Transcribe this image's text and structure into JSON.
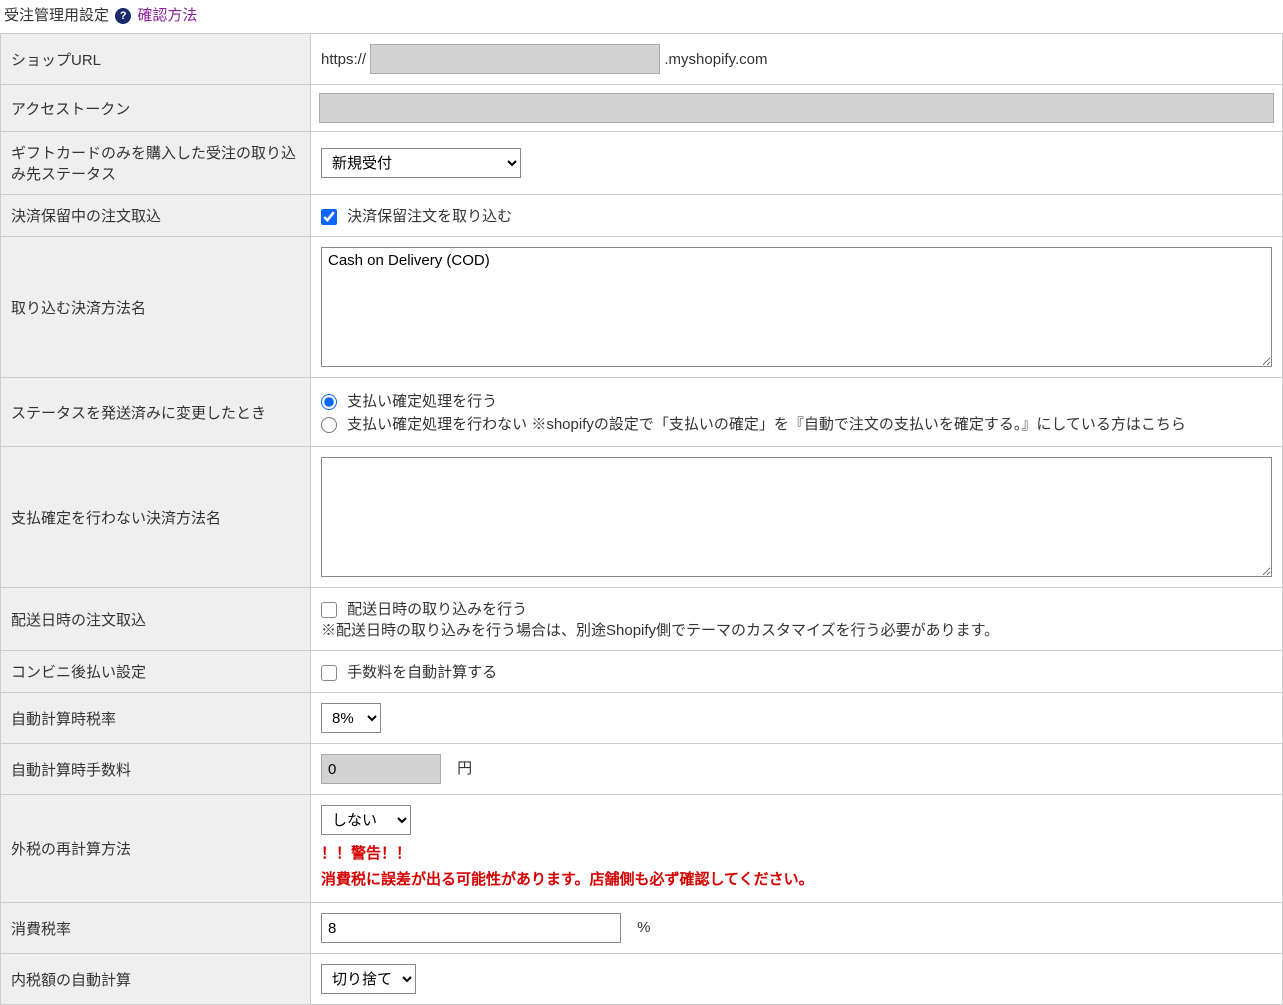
{
  "header": {
    "title": "受注管理用設定",
    "help_glyph": "?",
    "help_link": "確認方法"
  },
  "rows": {
    "shop_url": {
      "label": "ショップURL",
      "prefix": "https://",
      "value": "",
      "suffix": ".myshopify.com"
    },
    "access_token": {
      "label": "アクセストークン",
      "value": ""
    },
    "giftcard_status": {
      "label": "ギフトカードのみを購入した受注の取り込み先ステータス",
      "selected": "新規受付",
      "options": [
        "新規受付"
      ]
    },
    "pending_import": {
      "label": "決済保留中の注文取込",
      "checkbox_label": "決済保留注文を取り込む",
      "checked": true
    },
    "payment_methods_import": {
      "label": "取り込む決済方法名",
      "value": "Cash on Delivery (COD)"
    },
    "on_shipped": {
      "label": "ステータスを発送済みに変更したとき",
      "option1": "支払い確定処理を行う",
      "option2": "支払い確定処理を行わない ※shopifyの設定で「支払いの確定」を『自動で注文の支払いを確定する。』にしている方はこちら",
      "selected": 1
    },
    "exclude_capture_methods": {
      "label": "支払確定を行わない決済方法名",
      "value": ""
    },
    "delivery_datetime": {
      "label": "配送日時の注文取込",
      "checkbox_label": "配送日時の取り込みを行う",
      "checked": false,
      "note": "※配送日時の取り込みを行う場合は、別途Shopify側でテーマのカスタマイズを行う必要があります。"
    },
    "convenience_postpay": {
      "label": "コンビニ後払い設定",
      "checkbox_label": "手数料を自動計算する",
      "checked": false
    },
    "auto_tax_rate": {
      "label": "自動計算時税率",
      "selected": "8%",
      "options": [
        "8%"
      ]
    },
    "auto_fee": {
      "label": "自動計算時手数料",
      "value": "0",
      "unit": "円"
    },
    "ext_tax_recalc": {
      "label": "外税の再計算方法",
      "selected": "しない",
      "options": [
        "しない"
      ],
      "warn1": "！！警告！！",
      "warn2": "消費税に誤差が出る可能性があります。店舗側も必ず確認してください。"
    },
    "consumption_tax_rate": {
      "label": "消費税率",
      "value": "8",
      "unit": "%"
    },
    "incl_tax_auto": {
      "label": "内税額の自動計算",
      "selected": "切り捨て",
      "options": [
        "切り捨て"
      ]
    }
  }
}
